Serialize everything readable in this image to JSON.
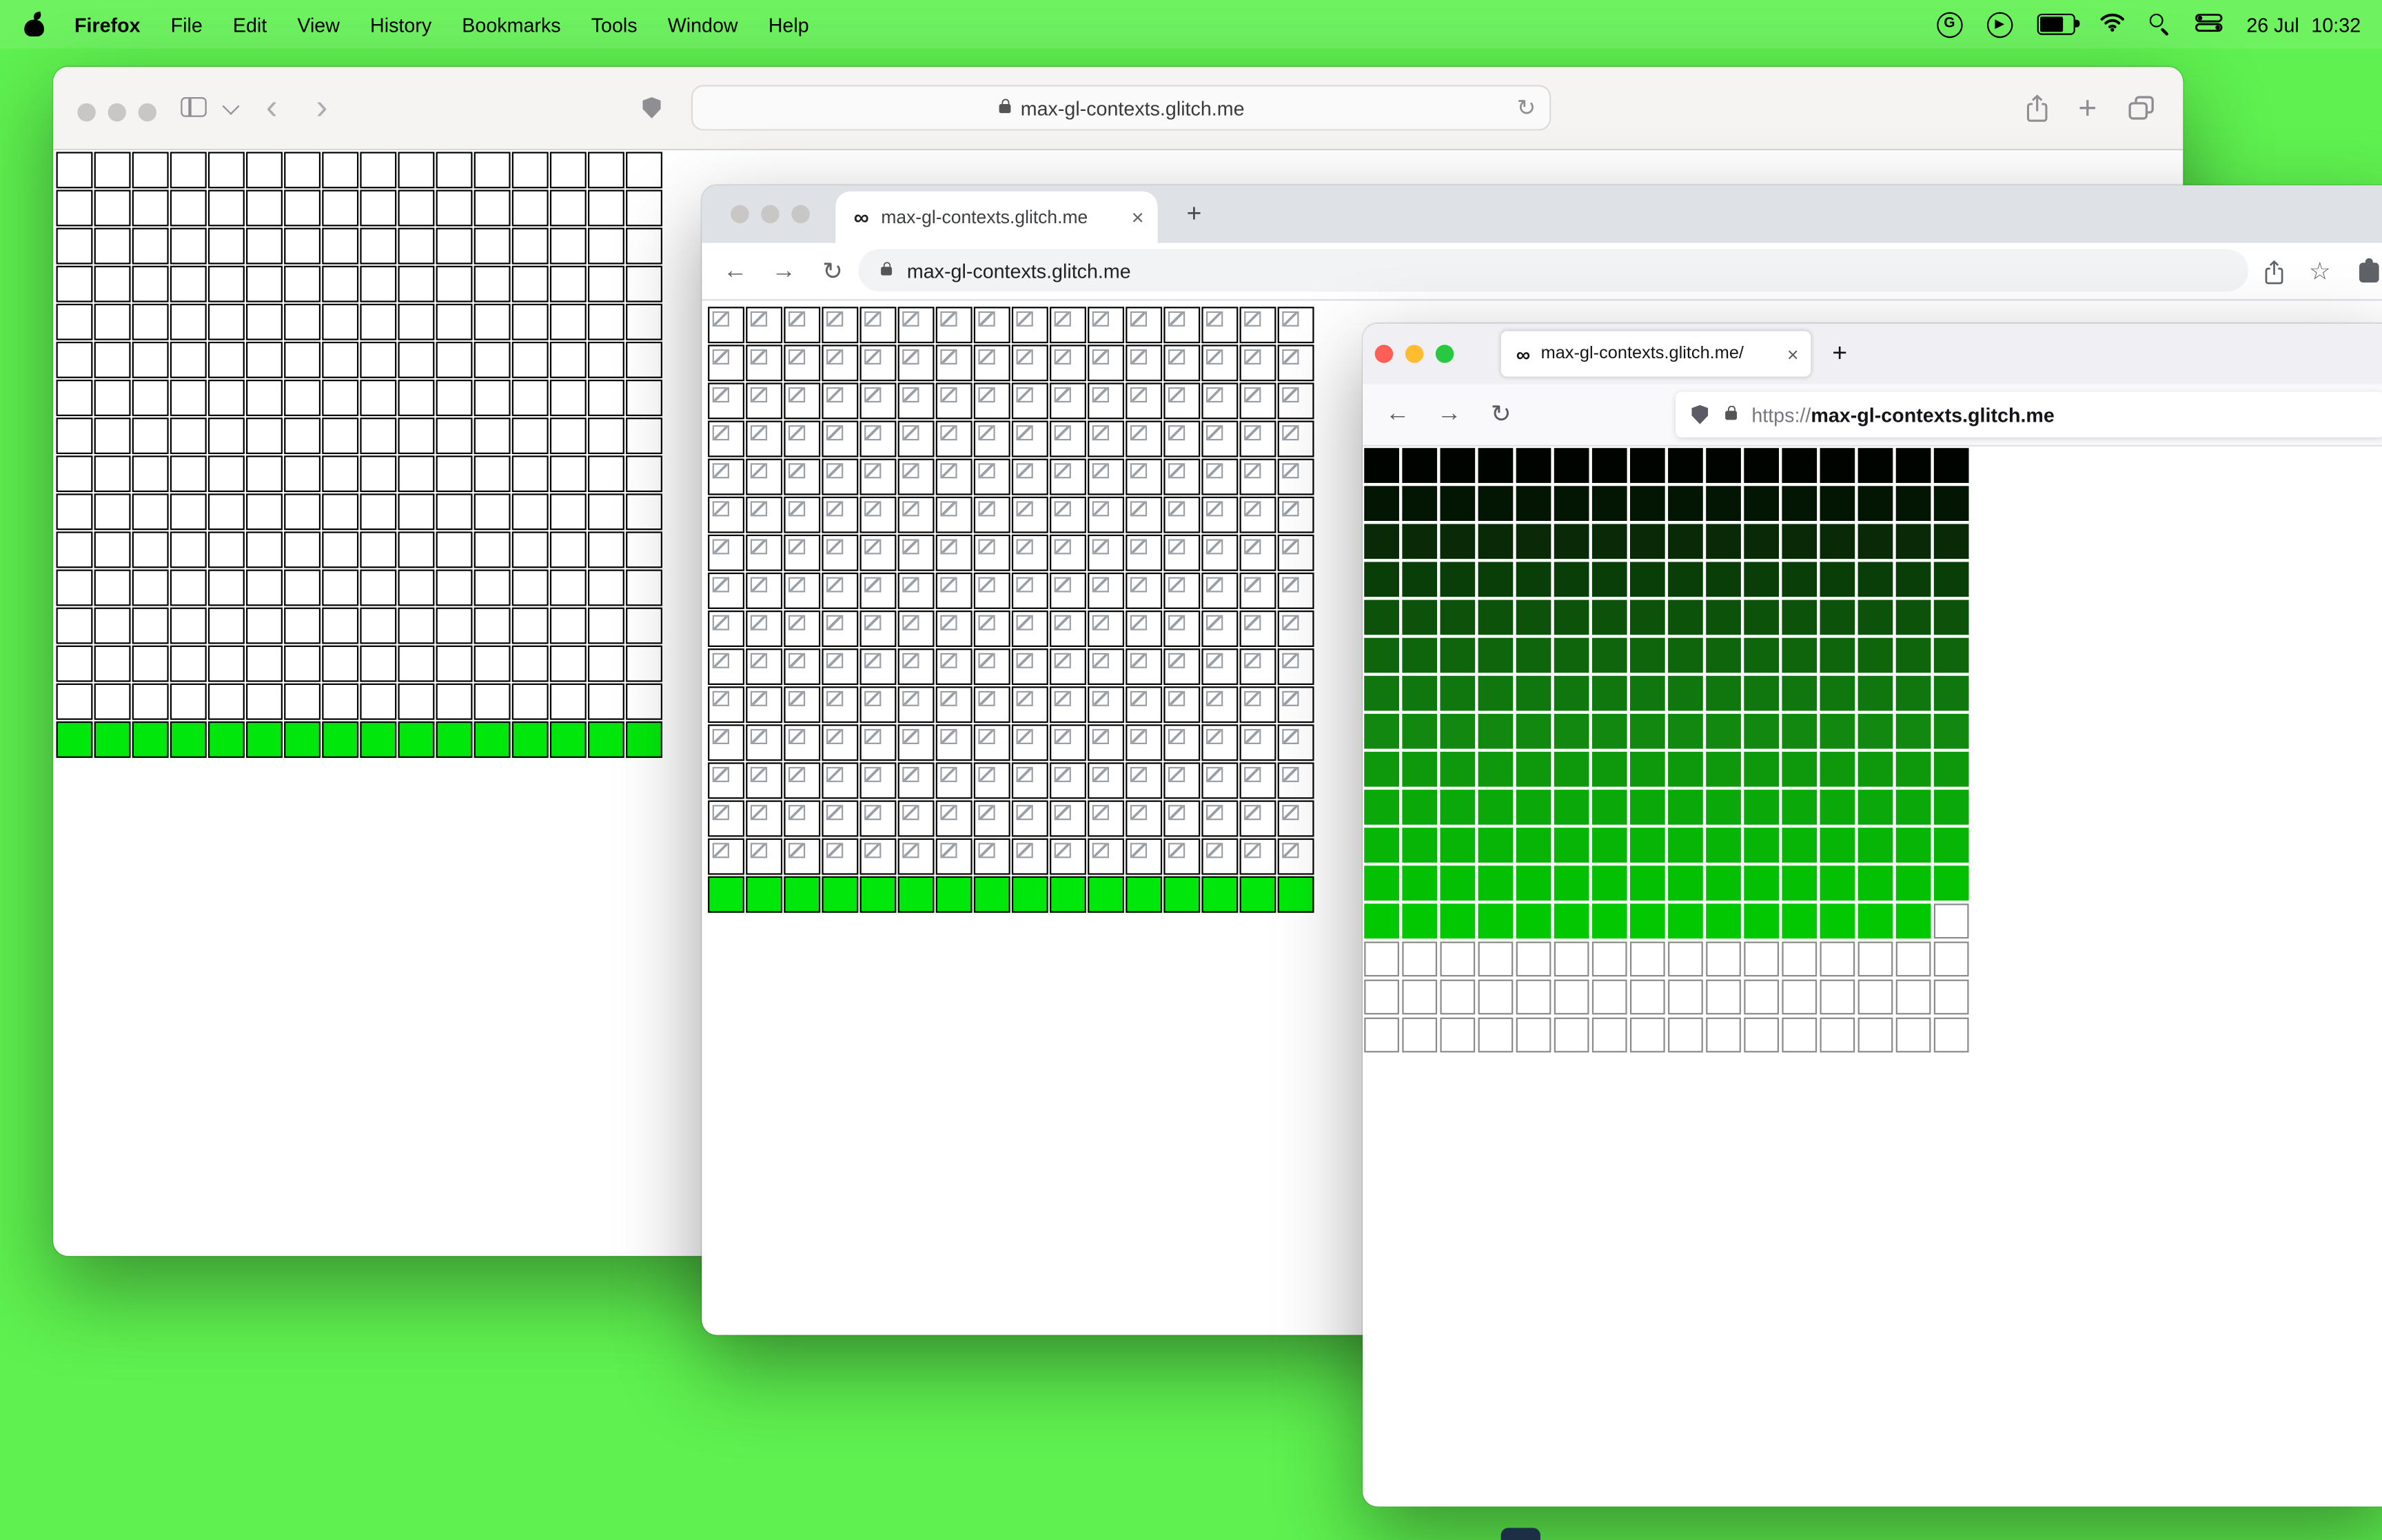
{
  "menubar": {
    "app_name": "Firefox",
    "menus": [
      "File",
      "Edit",
      "View",
      "History",
      "Bookmarks",
      "Tools",
      "Window",
      "Help"
    ],
    "date": "26 Jul",
    "time": "10:32"
  },
  "icons": {
    "g_logo": "G",
    "play": "▶",
    "infinity": "∞",
    "close": "×",
    "plus": "+",
    "back_arrow": "←",
    "forward_arrow": "→",
    "reload": "↻",
    "back_chevron": "‹",
    "forward_chevron": "›",
    "star": "☆"
  },
  "colors": {
    "desktop_green": "#5ef14f",
    "bright_green": "#00e70b"
  },
  "safari": {
    "url": "max-gl-contexts.glitch.me",
    "grid": {
      "cols": 16,
      "rows": [
        {
          "repeat": 15,
          "type": "white"
        },
        {
          "type": "green",
          "color": "#00e70b"
        }
      ]
    }
  },
  "chrome": {
    "tab_title": "max-gl-contexts.glitch.me",
    "url": "max-gl-contexts.glitch.me",
    "grid": {
      "cols": 16,
      "rows": [
        {
          "repeat": 15,
          "type": "broken"
        },
        {
          "type": "green",
          "color": "#00e70b"
        }
      ]
    }
  },
  "firefox": {
    "tab_title": "max-gl-contexts.glitch.me/",
    "url_scheme": "https://",
    "url_host": "max-gl-contexts.glitch.me",
    "grid": {
      "cols": 16,
      "rows": [
        {
          "type": "solid",
          "color": "#000400"
        },
        {
          "type": "solid",
          "color": "#031503"
        },
        {
          "type": "solid",
          "color": "#082a06"
        },
        {
          "type": "solid",
          "color": "#0a3e08"
        },
        {
          "type": "solid",
          "color": "#0c520a"
        },
        {
          "type": "solid",
          "color": "#0e650c"
        },
        {
          "type": "solid",
          "color": "#0f770d"
        },
        {
          "type": "solid",
          "color": "#10890e"
        },
        {
          "type": "solid",
          "color": "#0d990b"
        },
        {
          "type": "solid",
          "color": "#0aa808"
        },
        {
          "type": "solid",
          "color": "#06b505"
        },
        {
          "type": "solid",
          "color": "#03c003"
        },
        {
          "type": "solid",
          "color": "#01c801",
          "filled": 15,
          "rest": "white"
        },
        {
          "repeat": 3,
          "type": "white"
        }
      ]
    }
  }
}
